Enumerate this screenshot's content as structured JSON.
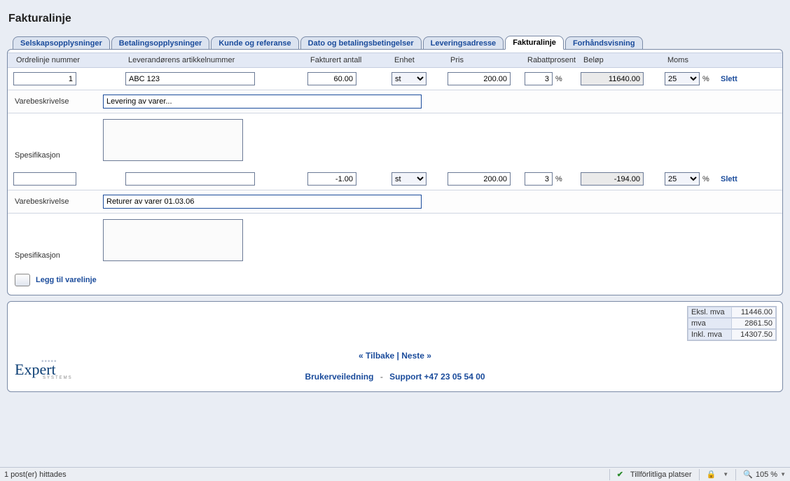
{
  "title": "Fakturalinje",
  "tabs": [
    {
      "label": "Selskapsopplysninger",
      "active": false
    },
    {
      "label": "Betalingsopplysninger",
      "active": false
    },
    {
      "label": "Kunde og referanse",
      "active": false
    },
    {
      "label": "Dato og betalingsbetingelser",
      "active": false
    },
    {
      "label": "Leveringsadresse",
      "active": false
    },
    {
      "label": "Fakturalinje",
      "active": true
    },
    {
      "label": "Forhåndsvisning",
      "active": false
    }
  ],
  "columns": {
    "orderline": "Ordrelinje nummer",
    "artno": "Leverandørens artikkelnummer",
    "qty": "Fakturert antall",
    "unit": "Enhet",
    "price": "Pris",
    "discount": "Rabattprosent",
    "amount": "Beløp",
    "vat": "Moms"
  },
  "unit_symbol": "%",
  "unit_options": [
    "st"
  ],
  "vat_options": [
    "25"
  ],
  "lines": [
    {
      "orderline": "1",
      "artno": "ABC 123",
      "qty": "60.00",
      "unit": "st",
      "price": "200.00",
      "discount": "3",
      "amount": "11640.00",
      "vat": "25",
      "desc_label": "Varebeskrivelse",
      "desc_value": "Levering av varer...",
      "spec_label": "Spesifikasjon",
      "spec_value": "",
      "delete": "Slett"
    },
    {
      "orderline": "",
      "artno": "",
      "qty": "-1.00",
      "unit": "st",
      "price": "200.00",
      "discount": "3",
      "amount": "-194.00",
      "vat": "25",
      "desc_label": "Varebeskrivelse",
      "desc_value": "Returer av varer 01.03.06",
      "spec_label": "Spesifikasjon",
      "spec_value": "",
      "delete": "Slett"
    }
  ],
  "addline": "Legg til varelinje",
  "totals": {
    "ex_label": "Eksl. mva",
    "ex_value": "11446.00",
    "vat_label": "mva",
    "vat_value": "2861.50",
    "inc_label": "Inkl. mva",
    "inc_value": "14307.50"
  },
  "nav": {
    "back": "« Tilbake",
    "sep": " | ",
    "next": "Neste »"
  },
  "links": {
    "guide": "Brukerveiledning",
    "support": "Support +47 23 05 54 00"
  },
  "logo": {
    "brand": "Expert",
    "sub": "SYSTEMS"
  },
  "status": {
    "left": "1 post(er) hittades",
    "trusted": "Tillförlitliga platser",
    "zoom": "105 %"
  }
}
